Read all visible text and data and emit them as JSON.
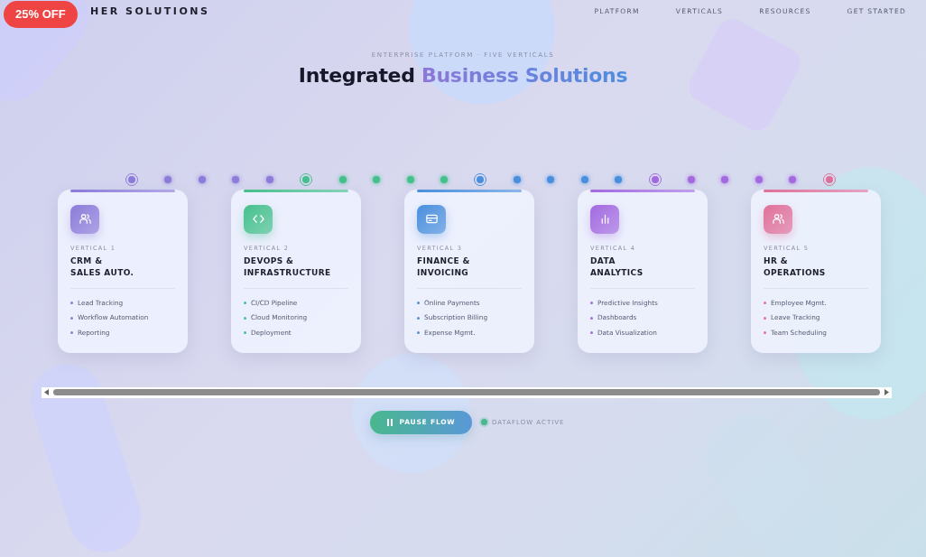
{
  "badge": "25% OFF",
  "brand": "HER SOLUTIONS",
  "nav": [
    {
      "label": "PLATFORM"
    },
    {
      "label": "VERTICALS"
    },
    {
      "label": "RESOURCES"
    },
    {
      "label": "GET STARTED"
    }
  ],
  "eyebrow": "ENTERPRISE PLATFORM · FIVE VERTICALS",
  "title": {
    "lead": "Integrated",
    "highlight": "Business Solutions"
  },
  "verticals": [
    {
      "label": "VERTICAL 1",
      "name": "CRM &\nSALES AUTO.",
      "kind": "users",
      "color": "#8c7bd9",
      "features": [
        "Lead Tracking",
        "Workflow Automation",
        "Reporting"
      ]
    },
    {
      "label": "VERTICAL 2",
      "name": "DEVOPS &\nINFRASTRUCTURE",
      "kind": "code",
      "color": "#45c08c",
      "features": [
        "CI/CD Pipeline",
        "Cloud Monitoring",
        "Deployment"
      ]
    },
    {
      "label": "VERTICAL 3",
      "name": "FINANCE &\nINVOICING",
      "kind": "card",
      "color": "#4a8fdd",
      "features": [
        "Online Payments",
        "Subscription Billing",
        "Expense Mgmt."
      ]
    },
    {
      "label": "VERTICAL 4",
      "name": "DATA\nANALYTICS",
      "kind": "bars",
      "color": "#a36ae0",
      "features": [
        "Predictive Insights",
        "Dashboards",
        "Data Visualization"
      ]
    },
    {
      "label": "VERTICAL 5",
      "name": "HR &\nOPERATIONS",
      "kind": "users",
      "color": "#e0709a",
      "features": [
        "Employee Mgmt.",
        "Leave Tracking",
        "Team Scheduling"
      ]
    }
  ],
  "controls": {
    "button": "PAUSE FLOW",
    "status": "DATAFLOW ACTIVE",
    "active": true
  }
}
